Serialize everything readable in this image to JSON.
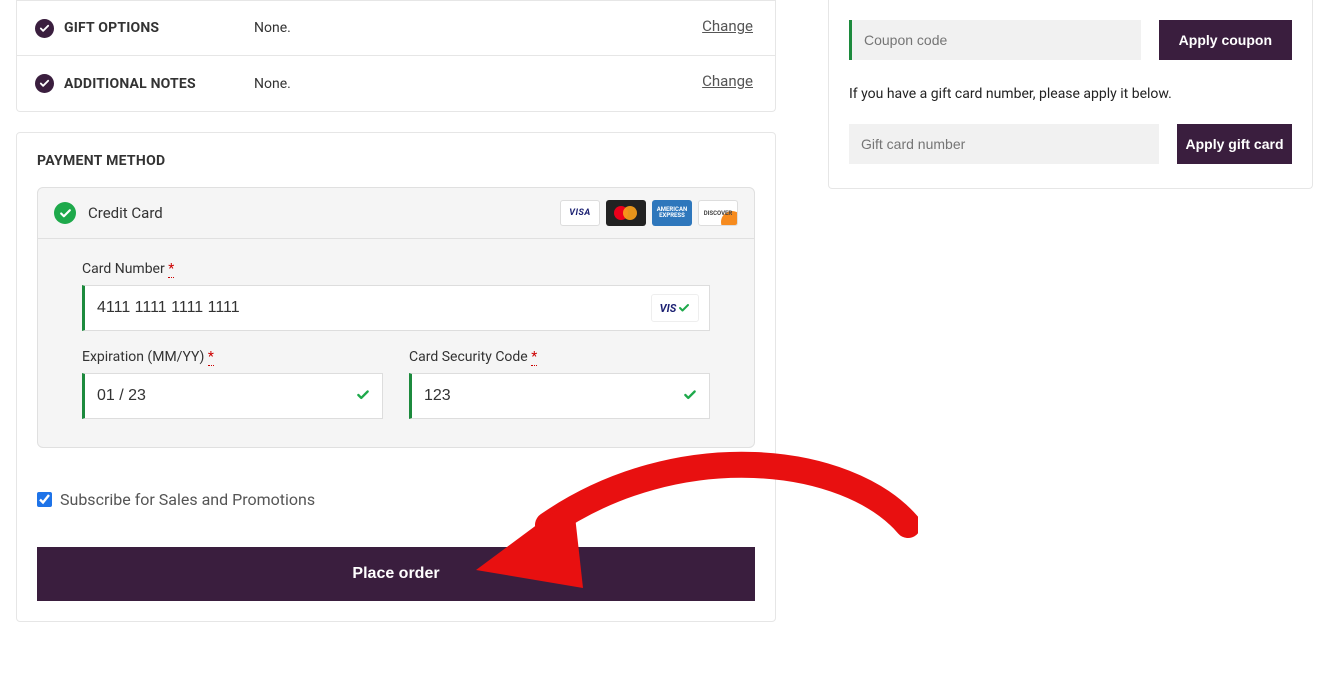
{
  "sections": {
    "gift": {
      "label": "GIFT OPTIONS",
      "value": "None.",
      "change": "Change"
    },
    "notes": {
      "label": "ADDITIONAL NOTES",
      "value": "None.",
      "change": "Change"
    }
  },
  "payment": {
    "title": "PAYMENT METHOD",
    "method_label": "Credit Card",
    "brands": {
      "visa": "VISA",
      "amex": "AMERICAN EXPRESS",
      "discover": "DISCOVER"
    },
    "card_number": {
      "label": "Card Number",
      "value": "4111 1111 1111 1111",
      "brand_badge": "VIS"
    },
    "expiration": {
      "label": "Expiration (MM/YY)",
      "value": "01 / 23"
    },
    "cvc": {
      "label": "Card Security Code",
      "value": "123"
    }
  },
  "subscribe": {
    "label": "Subscribe for Sales and Promotions",
    "checked": true
  },
  "place_order": "Place order",
  "sidebar": {
    "coupon": {
      "placeholder": "Coupon code",
      "button": "Apply coupon"
    },
    "gift_text": "If you have a gift card number, please apply it below.",
    "giftcard": {
      "placeholder": "Gift card number",
      "button": "Apply gift card"
    }
  }
}
